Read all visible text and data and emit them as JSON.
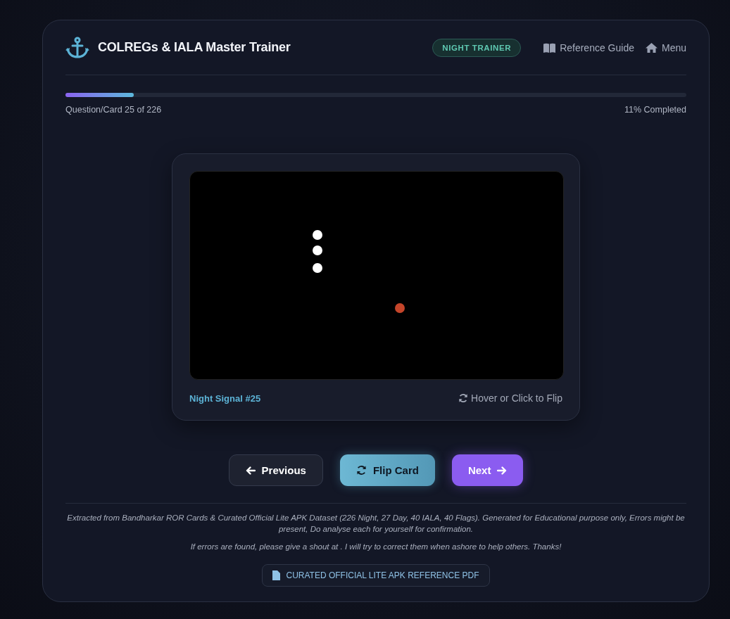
{
  "header": {
    "title": "COLREGs & IALA Master Trainer",
    "mode_badge": "NIGHT TRAINER",
    "nav": [
      {
        "kind": "book",
        "label": "Reference Guide"
      },
      {
        "kind": "home",
        "label": "Menu"
      }
    ]
  },
  "progress": {
    "level": 0.11,
    "counter": "Question/Card 25 of 226",
    "percent": "11% Completed"
  },
  "card": {
    "caption": "Night Signal #25",
    "hint": "Hover or Click to Flip"
  },
  "buttons": [
    {
      "kind": "previous",
      "label": "Previous"
    },
    {
      "kind": "flip",
      "label": "Flip Card"
    },
    {
      "kind": "next",
      "label": "Next"
    }
  ],
  "footer": {
    "notes": [
      "Extracted from Bandharkar ROR Cards & Curated Official Lite APK Dataset (226 Night, 27 Day, 40 IALA, 40 Flags). Generated for Educational purpose only, Errors might be present, Do analyse each for yourself for confirmation.",
      "If errors are found, please give a shout at . I will try to correct them when ashore to help others. Thanks!"
    ],
    "pdf_link": "CURATED OFFICIAL LITE APK REFERENCE PDF"
  }
}
